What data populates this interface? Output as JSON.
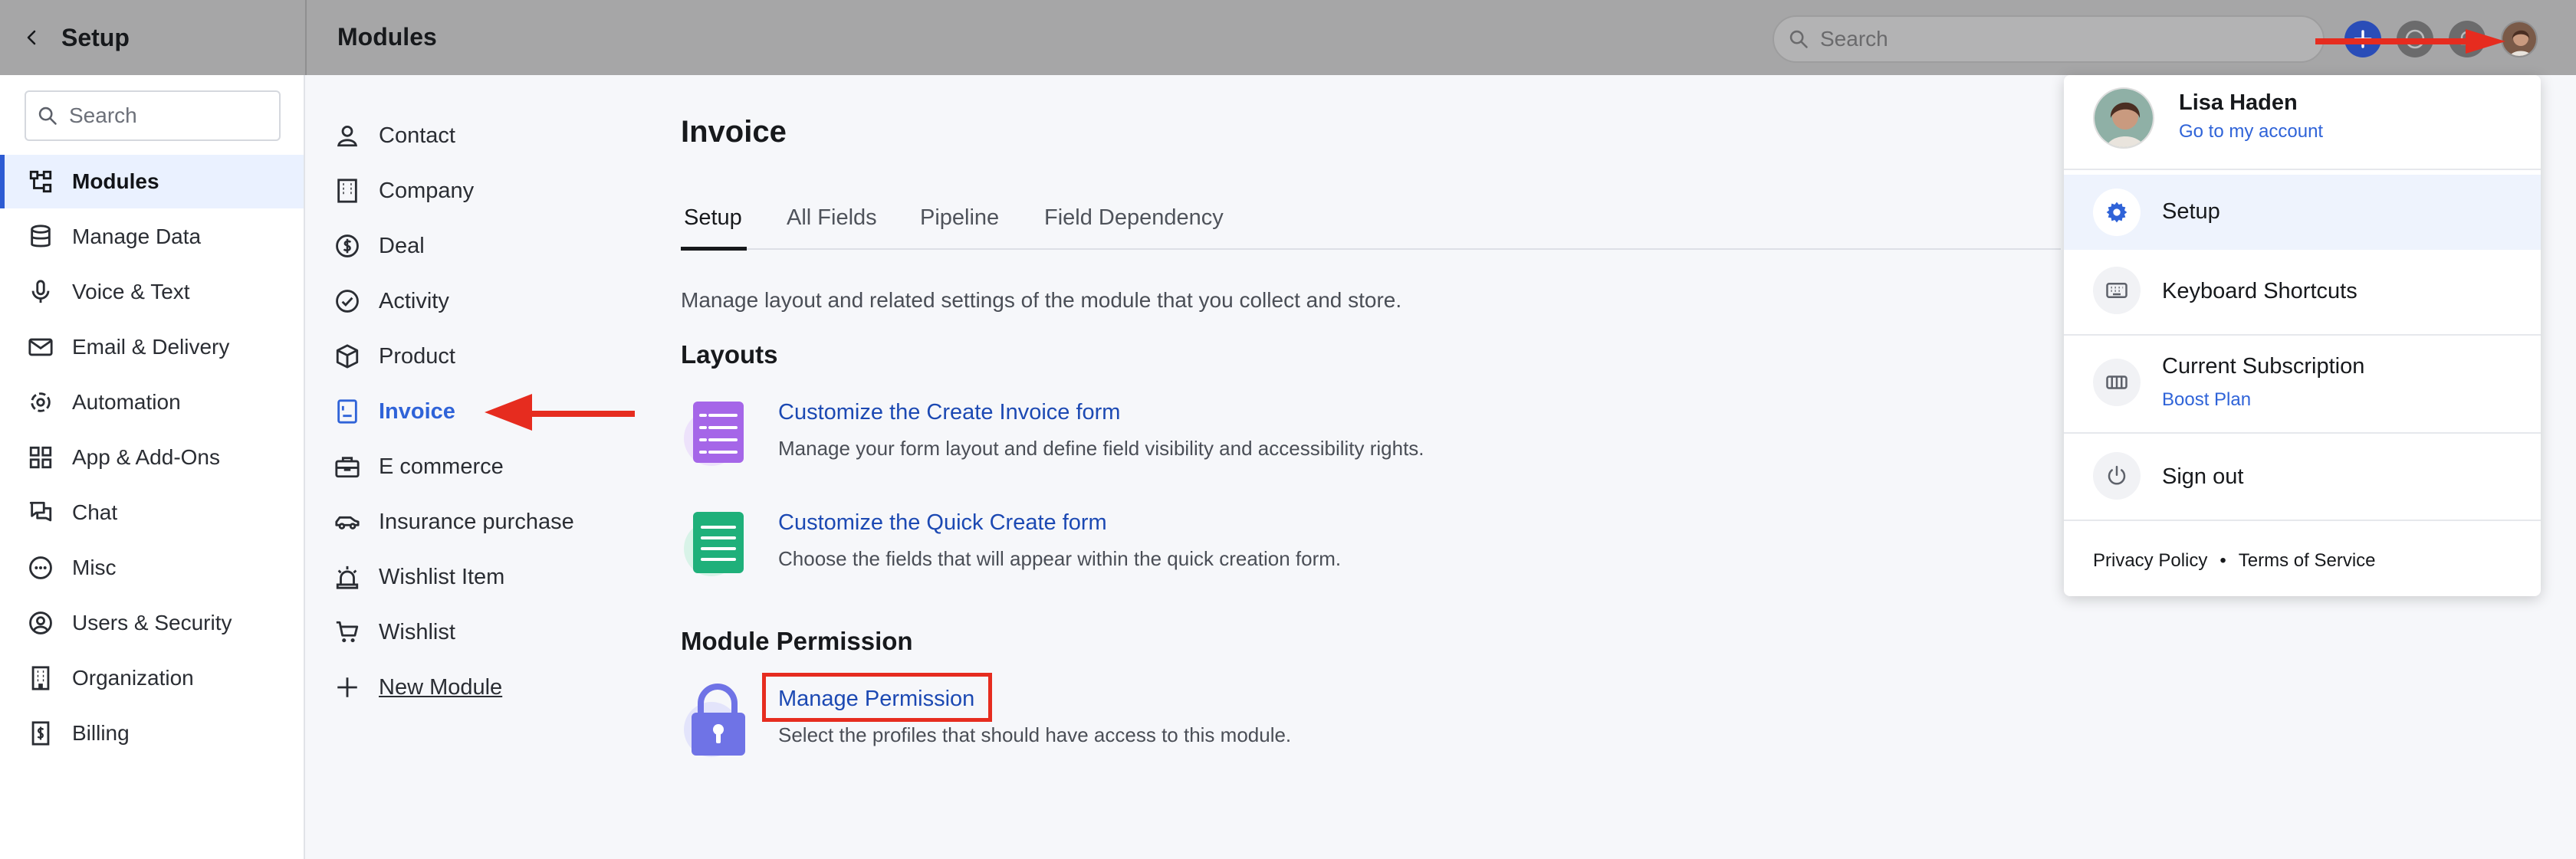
{
  "header": {
    "setup_title": "Setup",
    "modules_title": "Modules",
    "search_placeholder": "Search"
  },
  "sidebar": {
    "search_placeholder": "Search",
    "items": [
      {
        "label": "Modules",
        "icon": "modules-icon"
      },
      {
        "label": "Manage Data",
        "icon": "database-icon"
      },
      {
        "label": "Voice & Text",
        "icon": "microphone-icon"
      },
      {
        "label": "Email & Delivery",
        "icon": "mail-icon"
      },
      {
        "label": "Automation",
        "icon": "automation-icon"
      },
      {
        "label": "App & Add-Ons",
        "icon": "apps-grid-icon"
      },
      {
        "label": "Chat",
        "icon": "chat-icon"
      },
      {
        "label": "Misc",
        "icon": "more-icon"
      },
      {
        "label": "Users & Security",
        "icon": "user-circle-icon"
      },
      {
        "label": "Organization",
        "icon": "building-icon"
      },
      {
        "label": "Billing",
        "icon": "billing-icon"
      }
    ]
  },
  "modules": {
    "items": [
      {
        "label": "Contact",
        "icon": "person-icon"
      },
      {
        "label": "Company",
        "icon": "company-icon"
      },
      {
        "label": "Deal",
        "icon": "dollar-icon"
      },
      {
        "label": "Activity",
        "icon": "check-circle-icon"
      },
      {
        "label": "Product",
        "icon": "box-icon"
      },
      {
        "label": "Invoice",
        "icon": "invoice-icon"
      },
      {
        "label": "E commerce",
        "icon": "briefcase-icon"
      },
      {
        "label": "Insurance purchase",
        "icon": "car-icon"
      },
      {
        "label": "Wishlist Item",
        "icon": "siren-icon"
      },
      {
        "label": "Wishlist",
        "icon": "cart-icon"
      },
      {
        "label": "New Module",
        "icon": "plus-icon"
      }
    ]
  },
  "main": {
    "title": "Invoice",
    "tabs": [
      "Setup",
      "All Fields",
      "Pipeline",
      "Field Dependency"
    ],
    "description": "Manage layout and related settings of the module that you collect and store.",
    "layouts_heading": "Layouts",
    "create_form_link": "Customize the Create Invoice form",
    "create_form_desc": "Manage your form layout and define field visibility and accessibility rights.",
    "quick_form_link": "Customize the Quick Create form",
    "quick_form_desc": "Choose the fields that will appear within the quick creation form.",
    "permission_heading": "Module Permission",
    "permission_link": "Manage Permission",
    "permission_desc": "Select the profiles that should have access to this module."
  },
  "dropdown": {
    "user_name": "Lisa Haden",
    "account_link": "Go to my account",
    "setup": "Setup",
    "shortcuts": "Keyboard Shortcuts",
    "subscription": "Current Subscription",
    "plan": "Boost Plan",
    "sign_out": "Sign out",
    "privacy": "Privacy Policy",
    "terms": "Terms of Service",
    "separator": "•"
  },
  "colors": {
    "accent": "#2f63d8",
    "annotation_red": "#e62c1f",
    "form_icon_purple": "#a566e8",
    "form_icon_green": "#1fb07a",
    "lock_icon": "#6f73e6"
  }
}
